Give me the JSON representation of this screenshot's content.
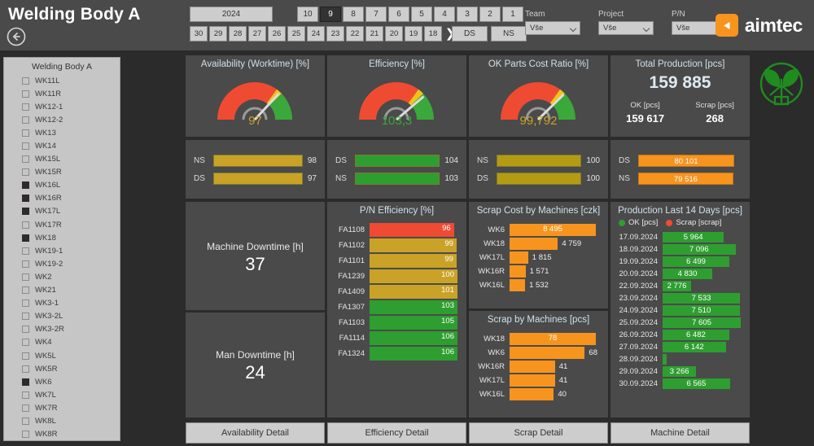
{
  "header": {
    "title": "Welding Body A",
    "back_icon": "back-arrow-icon",
    "year": "2024",
    "months": [
      "10",
      "9",
      "8",
      "7",
      "6",
      "5",
      "4",
      "3",
      "2",
      "1"
    ],
    "selected_month": "9",
    "days": [
      "30",
      "29",
      "28",
      "27",
      "26",
      "25",
      "24",
      "23",
      "22",
      "21",
      "20",
      "19",
      "18"
    ],
    "next_arrow": "❯",
    "shifts": [
      "DS",
      "NS"
    ],
    "filters": [
      {
        "label": "Team",
        "value": "Vše"
      },
      {
        "label": "Project",
        "value": "Vše"
      },
      {
        "label": "P/N",
        "value": "Vše"
      }
    ],
    "logo_text": "aimtec",
    "logo_mark": "triangle-play-icon"
  },
  "sidebar": {
    "title": "Welding Body A",
    "items": [
      {
        "label": "WK11L",
        "checked": false
      },
      {
        "label": "WK11R",
        "checked": false
      },
      {
        "label": "WK12-1",
        "checked": false
      },
      {
        "label": "WK12-2",
        "checked": false
      },
      {
        "label": "WK13",
        "checked": false
      },
      {
        "label": "WK14",
        "checked": false
      },
      {
        "label": "WK15L",
        "checked": false
      },
      {
        "label": "WK15R",
        "checked": false
      },
      {
        "label": "WK16L",
        "checked": true
      },
      {
        "label": "WK16R",
        "checked": true
      },
      {
        "label": "WK17L",
        "checked": true
      },
      {
        "label": "WK17R",
        "checked": false
      },
      {
        "label": "WK18",
        "checked": true
      },
      {
        "label": "WK19-1",
        "checked": false
      },
      {
        "label": "WK19-2",
        "checked": false
      },
      {
        "label": "WK2",
        "checked": false
      },
      {
        "label": "WK21",
        "checked": false
      },
      {
        "label": "WK3-1",
        "checked": false
      },
      {
        "label": "WK3-2L",
        "checked": false
      },
      {
        "label": "WK3-2R",
        "checked": false
      },
      {
        "label": "WK4",
        "checked": false
      },
      {
        "label": "WK5L",
        "checked": false
      },
      {
        "label": "WK5R",
        "checked": false
      },
      {
        "label": "WK6",
        "checked": true
      },
      {
        "label": "WK7L",
        "checked": false
      },
      {
        "label": "WK7R",
        "checked": false
      },
      {
        "label": "WK8L",
        "checked": false
      },
      {
        "label": "WK8R",
        "checked": false
      }
    ]
  },
  "gauges": [
    {
      "title": "Availability (Worktime) [%]",
      "value": "97",
      "value_color": "#c9a227",
      "needle_pct": 0.97
    },
    {
      "title": "Efficiency [%]",
      "value": "103,3",
      "value_color": "#3aa83a",
      "needle_pct": 1.02
    },
    {
      "title": "OK Parts Cost Ratio [%]",
      "value": "99,792",
      "value_color": "#c9a227",
      "needle_pct": 0.99
    }
  ],
  "total_production": {
    "title": "Total Production [pcs]",
    "value": "159 885",
    "ok_label": "OK [pcs]",
    "ok_value": "159 617",
    "scrap_label": "Scrap [pcs]",
    "scrap_value": "268"
  },
  "shift_bars": {
    "availability": [
      {
        "label": "NS",
        "value": "98",
        "pct": 0.98,
        "color": "#c9a227",
        "inside": false
      },
      {
        "label": "DS",
        "value": "97",
        "pct": 0.97,
        "color": "#c9a227",
        "inside": false
      }
    ],
    "efficiency": [
      {
        "label": "DS",
        "value": "104",
        "pct": 1.0,
        "color": "#2e9e30",
        "inside": false
      },
      {
        "label": "NS",
        "value": "103",
        "pct": 0.99,
        "color": "#2e9e30",
        "inside": false
      }
    ],
    "ok_parts": [
      {
        "label": "NS",
        "value": "100",
        "pct": 1.0,
        "color": "#b59a14",
        "inside": false
      },
      {
        "label": "DS",
        "value": "100",
        "pct": 1.0,
        "color": "#b59a14",
        "inside": false
      }
    ],
    "total_production": [
      {
        "label": "DS",
        "value": "80 101",
        "pct": 1.0,
        "color": "#f7941e",
        "inside": true
      },
      {
        "label": "NS",
        "value": "79 516",
        "pct": 0.99,
        "color": "#f7941e",
        "inside": true
      }
    ]
  },
  "downtime": {
    "machine_title": "Machine Downtime [h]",
    "machine_value": "37",
    "man_title": "Man Downtime [h]",
    "man_value": "24"
  },
  "chart_data": [
    {
      "type": "bar",
      "title": "P/N Efficiency [%]",
      "orientation": "horizontal",
      "categories": [
        "FA1108",
        "FA1102",
        "FA1101",
        "FA1239",
        "FA1409",
        "FA1307",
        "FA1103",
        "FA1114",
        "FA1324"
      ],
      "values": [
        96,
        99,
        99,
        100,
        101,
        103,
        105,
        106,
        106
      ],
      "value_labels": [
        "96",
        "99",
        "99",
        "100",
        "101",
        "103",
        "105",
        "106",
        "106"
      ],
      "colors": [
        "#ef4b33",
        "#c9a227",
        "#c9a227",
        "#c9a227",
        "#c9a227",
        "#2e9e30",
        "#2e9e30",
        "#2e9e30",
        "#2e9e30"
      ],
      "bar_pcts": [
        0.96,
        0.99,
        0.99,
        1.0,
        1.0,
        1.0,
        1.0,
        1.0,
        1.0
      ],
      "label_inside": true,
      "xlabel": "",
      "ylabel": ""
    },
    {
      "type": "bar",
      "title": "Scrap Cost by Machines [czk]",
      "orientation": "horizontal",
      "categories": [
        "WK6",
        "WK18",
        "WK17L",
        "WK16R",
        "WK16L"
      ],
      "values": [
        8495,
        4759,
        1815,
        1571,
        1532
      ],
      "value_labels": [
        "8 495",
        "4 759",
        "1 815",
        "1 571",
        "1 532"
      ],
      "colors": [
        "#f7941e",
        "#f7941e",
        "#f7941e",
        "#f7941e",
        "#f7941e"
      ],
      "bar_pcts": [
        1.0,
        0.56,
        0.215,
        0.185,
        0.18
      ],
      "label_inside_flags": [
        true,
        false,
        false,
        false,
        false
      ],
      "xlabel": "",
      "ylabel": ""
    },
    {
      "type": "bar",
      "title": "Scrap by Machines [pcs]",
      "orientation": "horizontal",
      "categories": [
        "WK18",
        "WK6",
        "WK16R",
        "WK17L",
        "WK16L"
      ],
      "values": [
        78,
        68,
        41,
        41,
        40
      ],
      "value_labels": [
        "78",
        "68",
        "41",
        "41",
        "40"
      ],
      "colors": [
        "#f7941e",
        "#f7941e",
        "#f7941e",
        "#f7941e",
        "#f7941e"
      ],
      "bar_pcts": [
        1.0,
        0.872,
        0.526,
        0.526,
        0.513
      ],
      "label_inside_flags": [
        true,
        false,
        false,
        false,
        false
      ],
      "xlabel": "",
      "ylabel": ""
    },
    {
      "type": "bar",
      "title": "Production Last 14 Days [pcs]",
      "orientation": "horizontal",
      "legend": [
        {
          "label": "OK [pcs]",
          "color": "#2e9e30"
        },
        {
          "label": "Scrap [scrap]",
          "color": "#ef4b33"
        }
      ],
      "legend_position": "top-left",
      "categories": [
        "17.09.2024",
        "18.09.2024",
        "19.09.2024",
        "20.09.2024",
        "22.09.2024",
        "23.09.2024",
        "24.09.2024",
        "25.09.2024",
        "26.09.2024",
        "27.09.2024",
        "28.09.2024",
        "29.09.2024",
        "30.09.2024"
      ],
      "values": [
        5964,
        7096,
        6499,
        4830,
        2776,
        7533,
        7510,
        7605,
        6482,
        6142,
        430,
        3266,
        6565
      ],
      "value_labels": [
        "5 964",
        "7 096",
        "6 499",
        "4 830",
        "2 776",
        "7 533",
        "7 510",
        "7 605",
        "6 482",
        "6 142",
        "",
        "3 266",
        "6 565"
      ],
      "colors": [
        "#2e9e30",
        "#2e9e30",
        "#2e9e30",
        "#2e9e30",
        "#2e9e30",
        "#2e9e30",
        "#2e9e30",
        "#2e9e30",
        "#2e9e30",
        "#2e9e30",
        "#2e9e30",
        "#2e9e30",
        "#2e9e30"
      ],
      "bar_pcts": [
        0.784,
        0.933,
        0.855,
        0.635,
        0.365,
        0.99,
        0.988,
        1.0,
        0.852,
        0.808,
        0.057,
        0.43,
        0.863
      ],
      "label_inside": true,
      "xlabel": "",
      "ylabel": ""
    }
  ],
  "bottom_buttons": [
    {
      "label": "Availability Detail"
    },
    {
      "label": "Efficiency Detail"
    },
    {
      "label": "Scrap Detail"
    },
    {
      "label": "Machine Detail"
    }
  ],
  "plant_logo": "green-leaf-plant-logo"
}
